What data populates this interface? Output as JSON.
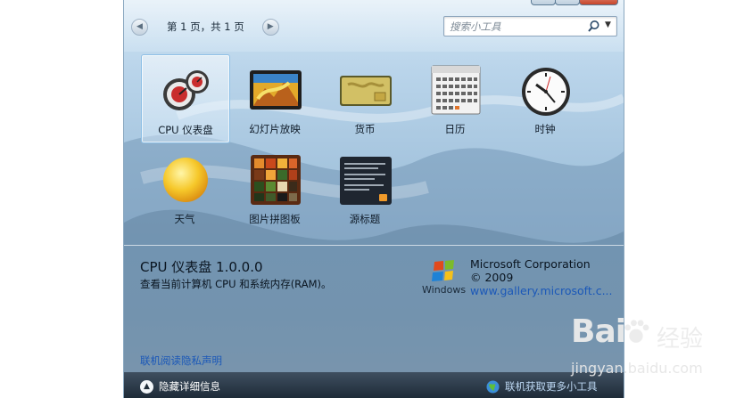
{
  "header": {
    "prev_icon": "chevron-left-icon",
    "next_icon": "chevron-right-icon",
    "page_label": "第 1 页，共 1 页"
  },
  "search": {
    "placeholder": "搜索小工具",
    "icon": "search-icon",
    "dropdown_icon": "chevron-down-icon"
  },
  "gadgets": [
    {
      "label": "CPU 仪表盘",
      "icon": "cpu-meter-icon",
      "selected": true
    },
    {
      "label": "幻灯片放映",
      "icon": "slideshow-icon",
      "selected": false
    },
    {
      "label": "货币",
      "icon": "currency-icon",
      "selected": false
    },
    {
      "label": "日历",
      "icon": "calendar-icon",
      "selected": false
    },
    {
      "label": "时钟",
      "icon": "clock-icon",
      "selected": false
    },
    {
      "label": "天气",
      "icon": "weather-icon",
      "selected": false
    },
    {
      "label": "图片拼图板",
      "icon": "picture-puzzle-icon",
      "selected": false
    },
    {
      "label": "源标题",
      "icon": "feed-headlines-icon",
      "selected": false
    }
  ],
  "details": {
    "title": "CPU 仪表盘 1.0.0.0",
    "description": "查看当前计算机 CPU 和系统内存(RAM)。",
    "vendor": "Microsoft Corporation",
    "copyright": "© 2009",
    "website": "www.gallery.microsoft.c...",
    "logo_text": "Windows",
    "privacy_link": "联机阅读隐私声明"
  },
  "footer": {
    "hide_details": "隐藏详细信息",
    "get_more": "联机获取更多小工具"
  },
  "watermark": {
    "brand": "Bai",
    "brand_cn": "经验",
    "url": "jingyan.baidu.com"
  },
  "colors": {
    "link": "#1b58b8",
    "bottom_bar": "#2a3948",
    "selection_border": "#8cbfe6"
  }
}
